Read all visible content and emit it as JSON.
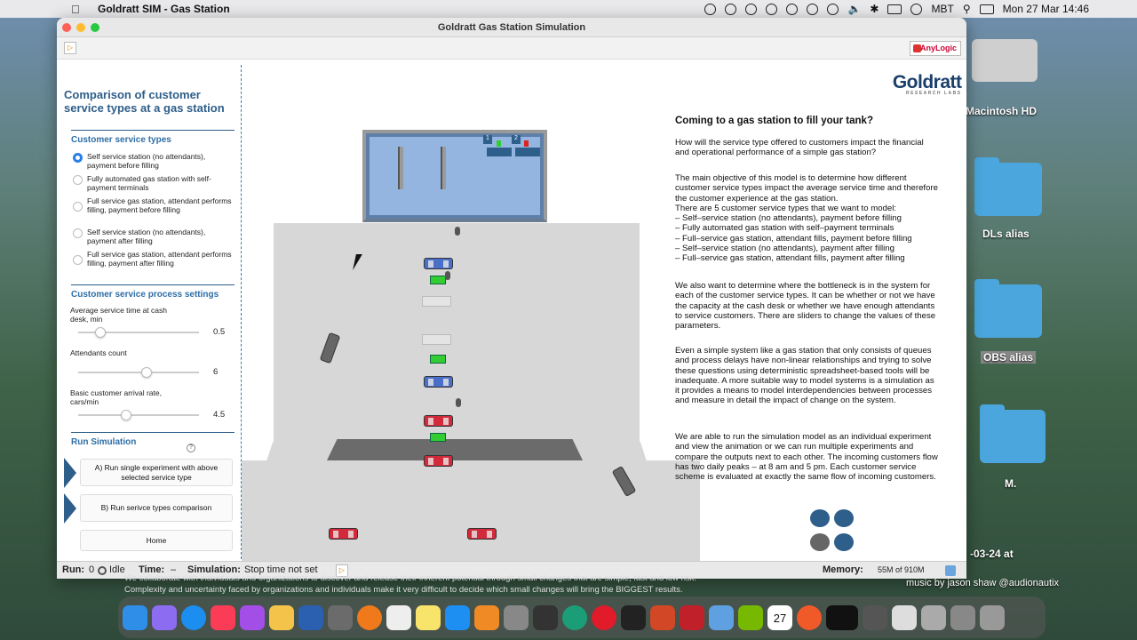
{
  "menubar": {
    "app_name": "Goldratt SIM - Gas Station",
    "keyboard": "MBT",
    "datetime": "Mon 27 Mar  14:46"
  },
  "window": {
    "title": "Goldratt Gas Station Simulation",
    "anylogic_label": "AnyLogic"
  },
  "sidebar": {
    "heading": "Comparison of customer service types at a gas station",
    "service_types_title": "Customer service types",
    "service_types": [
      {
        "label": "Self service station (no attendants), payment before filling",
        "selected": true
      },
      {
        "label": "Fully automated gas station with self-payment terminals",
        "selected": false
      },
      {
        "label": "Full service gas station, attendant performs filling, payment before filling",
        "selected": false
      },
      {
        "label": "Self service station (no attendants), payment after filling",
        "selected": false
      },
      {
        "label": "Full service gas station, attendant performs filling, payment after filling",
        "selected": false
      }
    ],
    "process_title": "Customer service process settings",
    "sliders": [
      {
        "label": "Average service time at cash desk, min",
        "value": "0.5",
        "position": 0.15
      },
      {
        "label": "Attendants count",
        "value": "6",
        "position": 0.57
      },
      {
        "label": "Basic customer arrival rate, cars/min",
        "value": "4.5",
        "position": 0.39
      }
    ],
    "run_title": "Run Simulation",
    "help": "?",
    "buttons": {
      "run_single": "A) Run single experiment with above selected service type",
      "run_compare": "B) Run serivce types comparison",
      "home": "Home"
    }
  },
  "content": {
    "logo": "Goldratt",
    "logo_sub": "RESEARCH LABS",
    "heading": "Coming to a gas station to fill your tank?",
    "intro": "How will the service type offered to customers impact the financial and operational performance of a simple gas station?",
    "objective": "The main objective of this model is to determine how different customer service types impact the average service time and therefore the customer experience at the gas station.",
    "types_intro": "There are 5 customer service types that we want to model:",
    "types_list": [
      "– Self–service station (no attendants), payment before filling",
      "– Fully automated gas station with self–payment terminals",
      "– Full–service gas station, attendant fills, payment before filling",
      "– Self–service station (no attendants), payment after filling",
      "– Full–service gas station, attendant fills, payment after filling"
    ],
    "bottleneck": "We also want to determine where the bottleneck is in the system for each of the customer service types. It can be whether or not we have the capacity at the cash desk or whether we have enough attendants to service customers. There are sliders to change the values of these parameters.",
    "simple_system": "Even a simple system like a gas station that only consists of queues and process delays have non-linear relationships and  trying to solve these questions using deterministic spreadsheet-based tools will be inadequate. A more suitable way to model systems is a simulation as it provides a means to model interdependencies between processes and measure in detail the impact of change on the system.",
    "run_info": "We are able to run the simulation model as an individual experiment and view the animation or we can run multiple experiments and compare the outputs next to each other. The incoming customers flow has two daily peaks – at 8 am and 5 pm. Each customer service scheme is evaluated at exactly the same flow of incoming customers.",
    "desk_numbers": [
      "1",
      "2"
    ]
  },
  "status": {
    "run_label": "Run:",
    "run_value": "0",
    "state": "Idle",
    "time_label": "Time:",
    "time_value": "–",
    "sim_label": "Simulation:",
    "sim_value": "Stop time not set",
    "memory_label": "Memory:",
    "memory_value": "55M of 910M"
  },
  "desktop": {
    "icons": [
      "Macintosh HD",
      "DLs alias",
      "OBS alias",
      "M.",
      "-03-24 at"
    ],
    "marquee1": "We collaborate with individuals and organizations to discover and release their inherent potential through small changes that are simple, fast and low risk.",
    "marquee2": "Complexity and uncertainty faced by organizations and individuals make it very difficult to decide which small changes will bring the BIGGEST results.",
    "credit": "music by jason shaw @audionautix",
    "calendar": "27"
  }
}
